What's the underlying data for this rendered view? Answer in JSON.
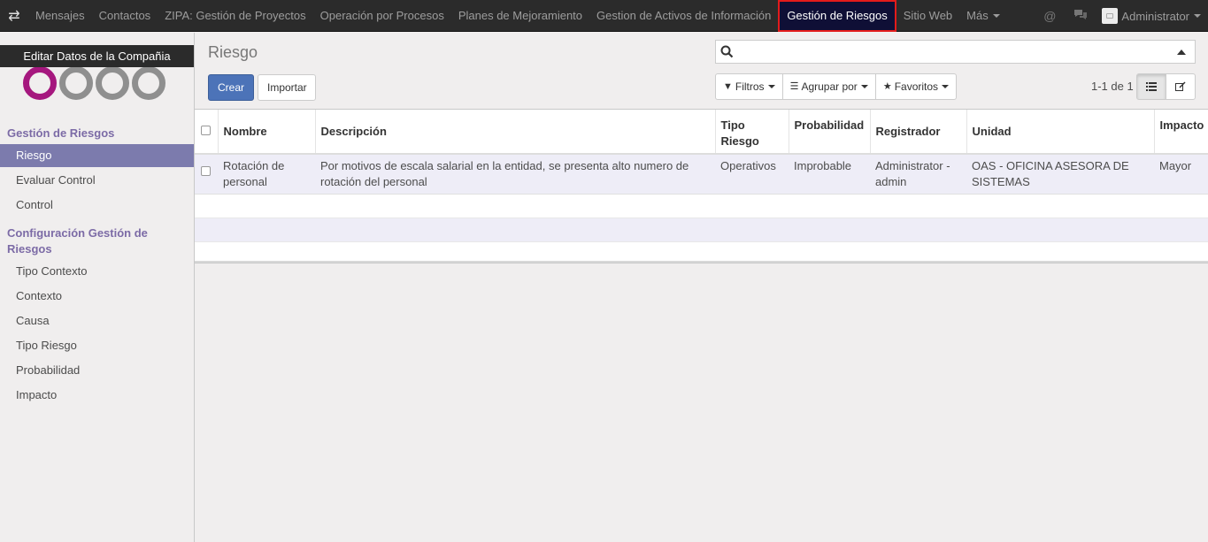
{
  "topbar": {
    "menu": [
      {
        "label": "Mensajes"
      },
      {
        "label": "Contactos"
      },
      {
        "label": "ZIPA: Gestión de Proyectos"
      },
      {
        "label": "Operación por Procesos"
      },
      {
        "label": "Planes de Mejoramiento"
      },
      {
        "label": "Gestion de Activos de Información"
      },
      {
        "label": "Gestión de Riesgos",
        "active": true
      },
      {
        "label": "Sitio Web"
      },
      {
        "label": "Más"
      }
    ],
    "user": "Administrator"
  },
  "sidebar": {
    "edit_company": "Editar Datos de la Compañia",
    "section1": "Gestión de Riesgos",
    "items1": [
      {
        "label": "Riesgo",
        "active": true
      },
      {
        "label": "Evaluar Control"
      },
      {
        "label": "Control"
      }
    ],
    "section2": "Configuración Gestión de Riesgos",
    "items2": [
      {
        "label": "Tipo Contexto"
      },
      {
        "label": "Contexto"
      },
      {
        "label": "Causa"
      },
      {
        "label": "Tipo Riesgo"
      },
      {
        "label": "Probabilidad"
      },
      {
        "label": "Impacto"
      }
    ]
  },
  "main": {
    "breadcrumb": "Riesgo",
    "create_label": "Crear",
    "import_label": "Importar",
    "search": {
      "value": "",
      "placeholder": ""
    },
    "filters_label": "Filtros",
    "group_label": "Agrupar por",
    "favorites_label": "Favoritos",
    "pager": "1-1 de 1"
  },
  "table": {
    "headers": {
      "nombre": "Nombre",
      "descripcion": "Descripción",
      "tipo_riesgo": "Tipo Riesgo",
      "probabilidad": "Probabilidad",
      "registrador": "Registrador",
      "unidad": "Unidad",
      "impacto": "Impacto"
    },
    "rows": [
      {
        "nombre": "Rotación de personal",
        "descripcion": "Por motivos de escala salarial en la entidad, se presenta alto numero de rotación del personal",
        "tipo_riesgo": "Operativos",
        "probabilidad": "Improbable",
        "registrador": "Administrator - admin",
        "unidad": "OAS - OFICINA ASESORA DE SISTEMAS",
        "impacto": "Mayor"
      }
    ]
  }
}
